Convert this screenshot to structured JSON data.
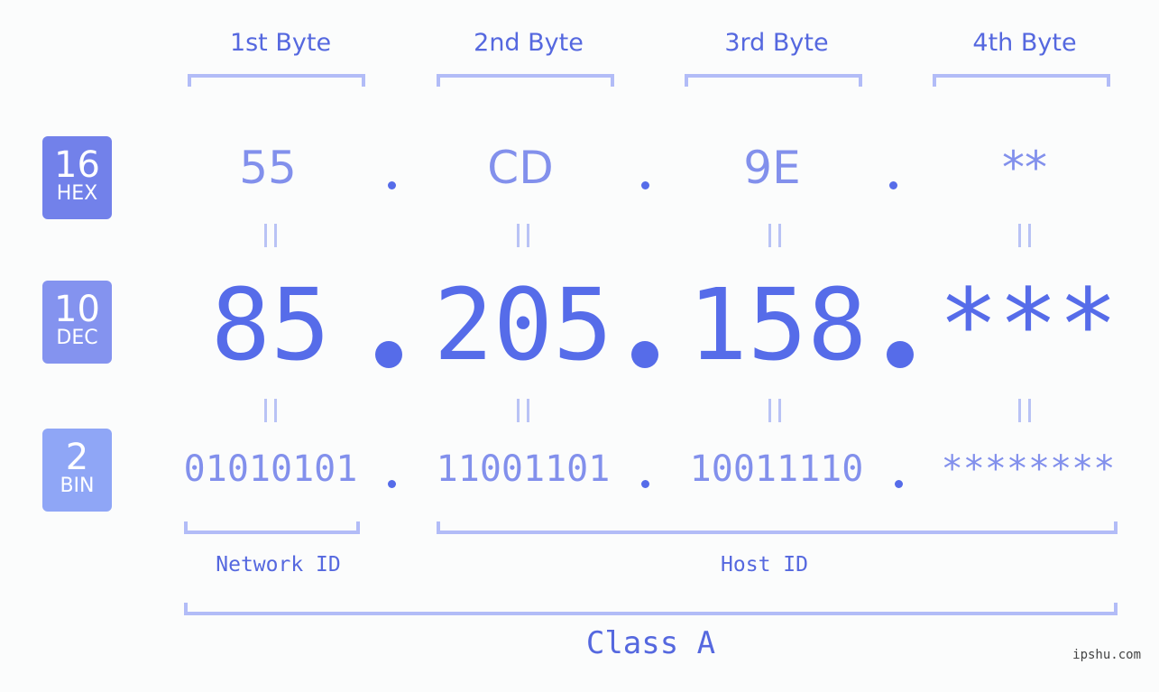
{
  "bytes": [
    {
      "label": "1st Byte",
      "hex": "55",
      "dec": "85",
      "bin": "01010101"
    },
    {
      "label": "2nd Byte",
      "hex": "CD",
      "dec": "205",
      "bin": "11001101"
    },
    {
      "label": "3rd Byte",
      "hex": "9E",
      "dec": "158",
      "bin": "10011110"
    },
    {
      "label": "4th Byte",
      "hex": "**",
      "dec": "***",
      "bin": "********"
    }
  ],
  "rows": {
    "hex": {
      "base": "16",
      "name": "HEX",
      "color": "#7281ea"
    },
    "dec": {
      "base": "10",
      "name": "DEC",
      "color": "#8493ef"
    },
    "bin": {
      "base": "2",
      "name": "BIN",
      "color": "#8fa6f6"
    }
  },
  "separators": {
    "dot": ".",
    "equals": "="
  },
  "sections": {
    "network": "Network ID",
    "host": "Host ID",
    "class": "Class A"
  },
  "watermark": "ipshu.com",
  "colors": {
    "accent": "#566ce9",
    "bracket": "#b2bcf7",
    "light_text": "#8290ec"
  }
}
